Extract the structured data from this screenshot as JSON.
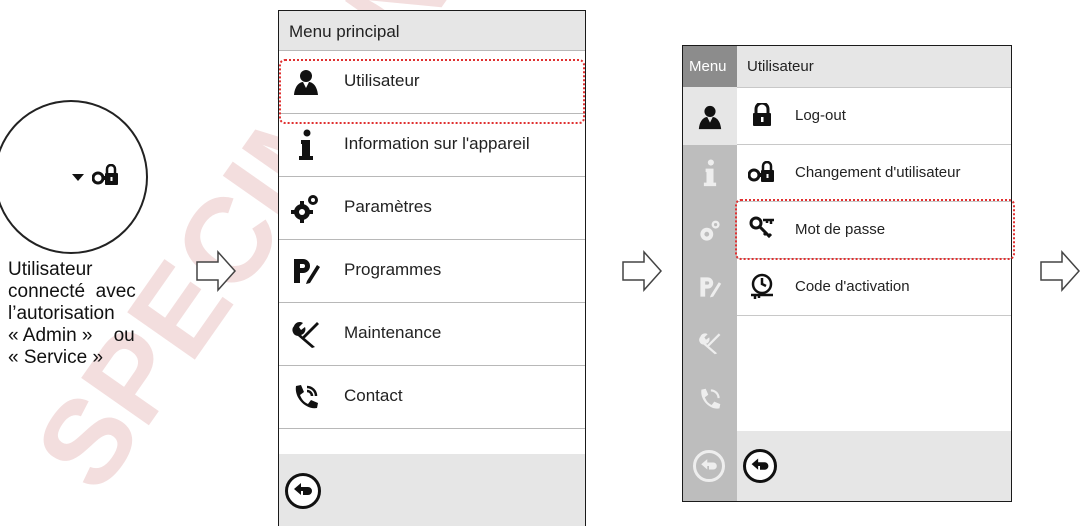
{
  "left_description": {
    "icons": [
      "caret-down-icon",
      "user-change-lock-icon"
    ],
    "lines": [
      "Utilisateur",
      "connecté  avec",
      "l’autorisation",
      "« Admin »    ou",
      "« Service »"
    ]
  },
  "main_menu": {
    "title": "Menu principal",
    "items": [
      {
        "label": "Utilisateur",
        "icon": "user-icon",
        "highlighted": true
      },
      {
        "label": "Information sur l'appareil",
        "icon": "info-icon"
      },
      {
        "label": "Paramètres",
        "icon": "gears-icon"
      },
      {
        "label": "Programmes",
        "icon": "program-edit-icon"
      },
      {
        "label": "Maintenance",
        "icon": "tools-icon"
      },
      {
        "label": "Contact",
        "icon": "phone-icon"
      }
    ],
    "back_icon": "back-arrow-icon"
  },
  "user_menu": {
    "sidebar_title": "Menu",
    "title": "Utilisateur",
    "items": [
      {
        "label": "Log-out",
        "icon": "lock-icon"
      },
      {
        "label": "Changement d'utilisateur",
        "icon": "user-change-lock-icon"
      },
      {
        "label": "Mot de passe",
        "icon": "keys-icon",
        "highlighted": true
      },
      {
        "label": "Code d'activation",
        "icon": "activation-code-icon"
      }
    ],
    "back_icon": "back-arrow-icon"
  },
  "colors": {
    "highlight": "#e03030",
    "header_bg": "#e6e6e6",
    "sidebar_bg": "#bdbdbd",
    "sidebar_header_bg": "#8c8c8c"
  }
}
